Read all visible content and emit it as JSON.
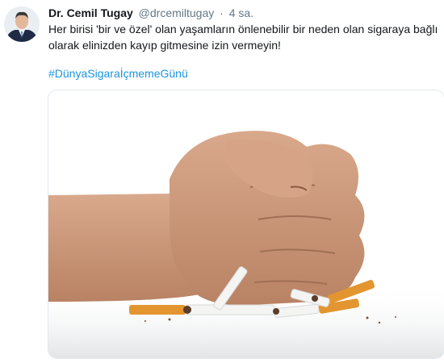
{
  "tweet": {
    "author_name": "Dr. Cemil Tugay",
    "handle": "@drcemiltugay",
    "separator": "·",
    "time": "4 sa.",
    "text": "Her birisi 'bir ve özel' olan yaşamların önlenebilir bir neden olan sigaraya bağlı olarak elinizden kayıp gitmesine izin vermeyin!",
    "hashtag": "#DünyaSigaraİçmemeGünü"
  },
  "icons": {
    "avatar": "profile-photo",
    "media": "fist-crushing-cigarettes-photo"
  },
  "colors": {
    "link": "#1b95e0",
    "text": "#14171a",
    "muted": "#657786"
  }
}
